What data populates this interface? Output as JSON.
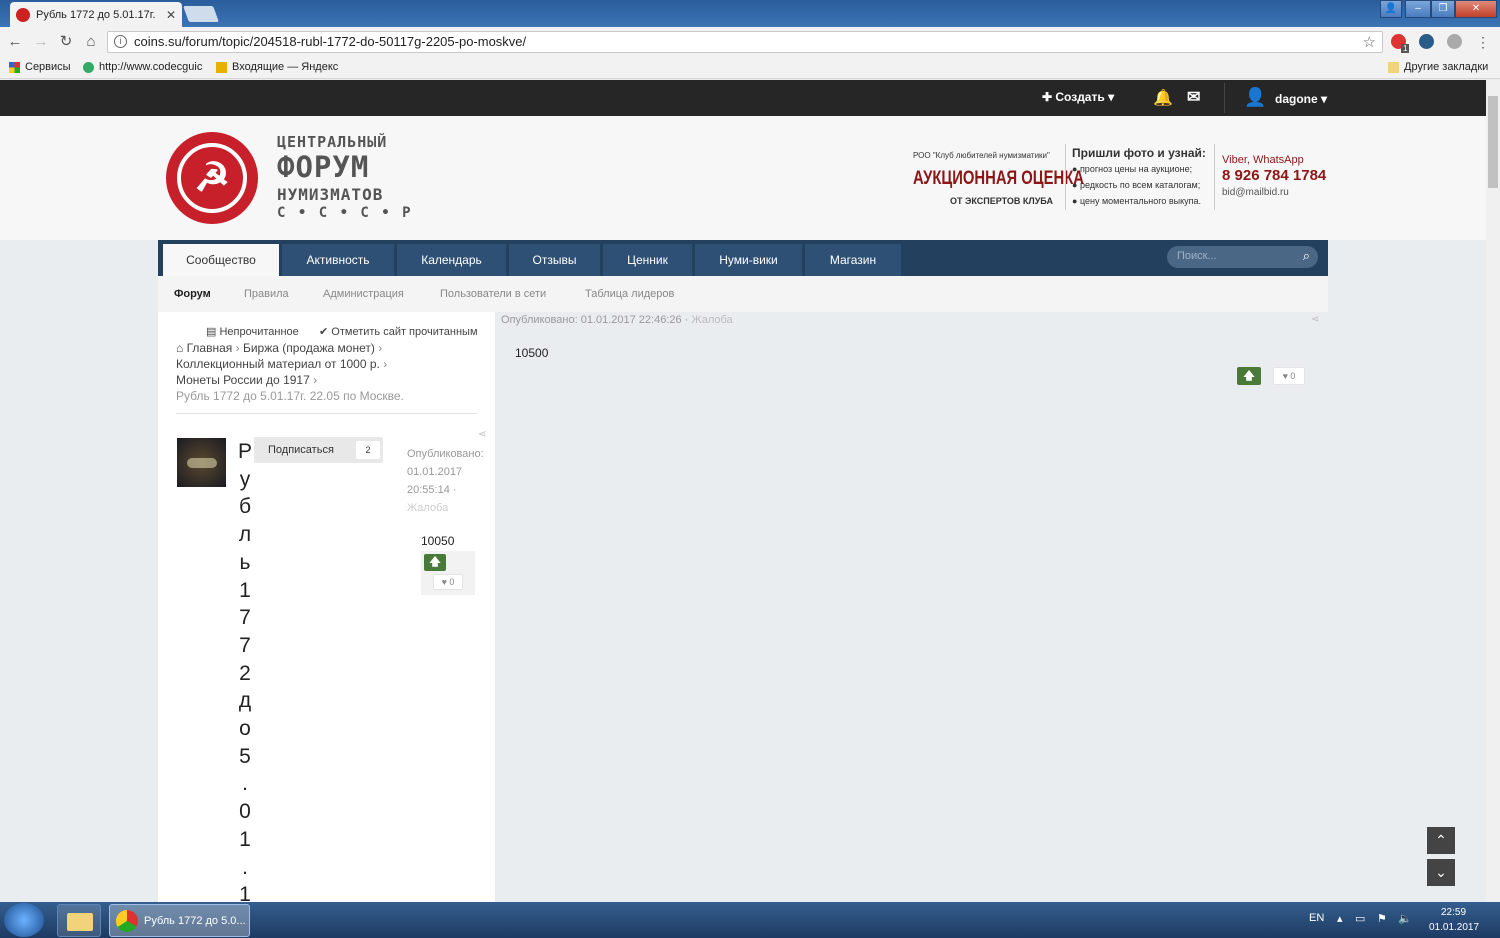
{
  "browser": {
    "tab_title": "Рубль 1772 до 5.01.17г.",
    "tab_close": "✕",
    "url": "coins.su/forum/topic/204518-rubl-1772-do-50117g-2205-po-moskve/",
    "bookmarks": [
      {
        "label": "Сервисы",
        "icon": "apps-icon"
      },
      {
        "label": "http://www.codecguic",
        "icon": "globe-icon"
      },
      {
        "label": "Входящие — Яндекс",
        "icon": "mail-icon"
      }
    ],
    "other_bookmarks": "Другие закладки",
    "extension_badge": "1"
  },
  "site": {
    "topbar": {
      "create_label": "Создать",
      "username": "dagone"
    },
    "logo": {
      "line1": "ЦЕНТРАЛЬНЫЙ",
      "line2": "ФОРУМ",
      "line3": "НУМИЗМАТОВ",
      "line4": "С • С • С • Р"
    },
    "ad": {
      "org": "РОО \"Клуб любителей нумизматики\"",
      "headline": "АУКЦИОННАЯ ОЦЕНКА",
      "sub": "ОТ ЭКСПЕРТОВ КЛУБА",
      "call": "Пришли фото и узнай:",
      "bullet1": "прогноз цены на аукционе;",
      "bullet2": "редкость по всем каталогам;",
      "bullet3": "цену моментального выкупа.",
      "contact_label": "Viber, WhatsApp",
      "phone": "8 926 784 1784",
      "email": "bid@mailbid.ru"
    },
    "nav": {
      "tabs": [
        "Сообщество",
        "Активность",
        "Календарь",
        "Отзывы",
        "Ценник",
        "Нуми-вики",
        "Магазин"
      ],
      "active": "Сообщество",
      "search_placeholder": "Поиск..."
    },
    "subnav": [
      "Форум",
      "Правила",
      "Администрация",
      "Пользователи в сети",
      "Таблица лидеров"
    ],
    "left": {
      "unread": "Непрочитанное",
      "mark_read": "Отметить сайт прочитанным",
      "breadcrumb": [
        "Главная",
        "Биржа (продажа монет)",
        "Коллекционный материал от 1000 р.",
        "Монеты России до 1917"
      ],
      "current": "Рубль 1772 до 5.01.17г. 22.05 по Москве.",
      "topic_title_chars": [
        "Р",
        "у",
        "б",
        "л",
        "ь",
        "1",
        "7",
        "7",
        "2",
        "д",
        "о",
        "5",
        ".",
        "0",
        "1",
        ".",
        "1"
      ],
      "subscribe": "Подписаться",
      "subscribe_count": "2",
      "post": {
        "published_label": "Опубликовано:",
        "date": "01.01.2017",
        "time": "20:55:14",
        "sep": "·",
        "report": "Жалоба",
        "body": "10050",
        "likes": "0"
      }
    },
    "right_post": {
      "published": "Опубликовано: 01.01.2017 22:46:26",
      "sep": "·",
      "report": "Жалоба",
      "body": "10500",
      "likes": "0"
    }
  },
  "taskbar": {
    "chrome_label": "Рубль 1772 до 5.0...",
    "lang": "EN",
    "time": "22:59",
    "date": "01.01.2017"
  }
}
